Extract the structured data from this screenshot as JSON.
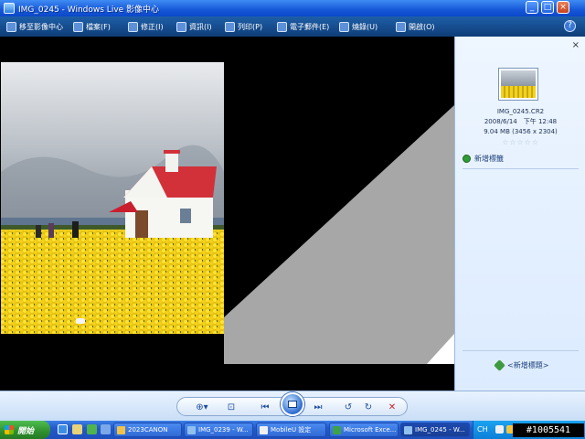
{
  "window": {
    "title": "IMG_0245 - Windows Live 影像中心",
    "controls": {
      "minimize": "_",
      "maximize": "□",
      "close": "×"
    }
  },
  "toolbar": {
    "items": [
      {
        "label": "移至影像中心",
        "icon": "back-arrow-icon"
      },
      {
        "label": "檔案(F)",
        "icon": "folder-icon"
      },
      {
        "label": "修正(I)",
        "icon": "fix-icon"
      },
      {
        "label": "資訊(I)",
        "icon": "info-icon"
      },
      {
        "label": "列印(P)",
        "icon": "print-icon"
      },
      {
        "label": "電子郵件(E)",
        "icon": "email-icon"
      },
      {
        "label": "燒錄(U)",
        "icon": "burn-disc-icon"
      },
      {
        "label": "開啟(O)",
        "icon": "open-icon"
      }
    ],
    "help": "?"
  },
  "photo": {
    "colors": {
      "sky": "#c8ccd0",
      "flowers": "#f2d21d",
      "roof": "#d8323a",
      "house": "#f4f4f2"
    }
  },
  "panel": {
    "close": "×",
    "file_name": "IMG_0245.CR2",
    "date": "2008/6/14　下午 12:48",
    "size": "9.04 MB (3456 x 2304)",
    "stars": "☆☆☆☆☆",
    "add_tag": "新增標籤",
    "add_caption": "<新增標題>"
  },
  "controls": {
    "zoom": "⊕▾",
    "fit": "⊡",
    "prev": "⏮",
    "next": "⏭",
    "rotate_ccw": "↺",
    "rotate_cw": "↻",
    "delete": "✕"
  },
  "taskbar": {
    "start": "開始",
    "tasks": [
      {
        "label": "2023CANON"
      },
      {
        "label": "IMG_0239 - W..."
      },
      {
        "label": "MobileU 設定"
      },
      {
        "label": "Microsoft Exce..."
      },
      {
        "label": "IMG_0245 - W..."
      }
    ],
    "lang": "CH",
    "watermark": "#1005541"
  }
}
